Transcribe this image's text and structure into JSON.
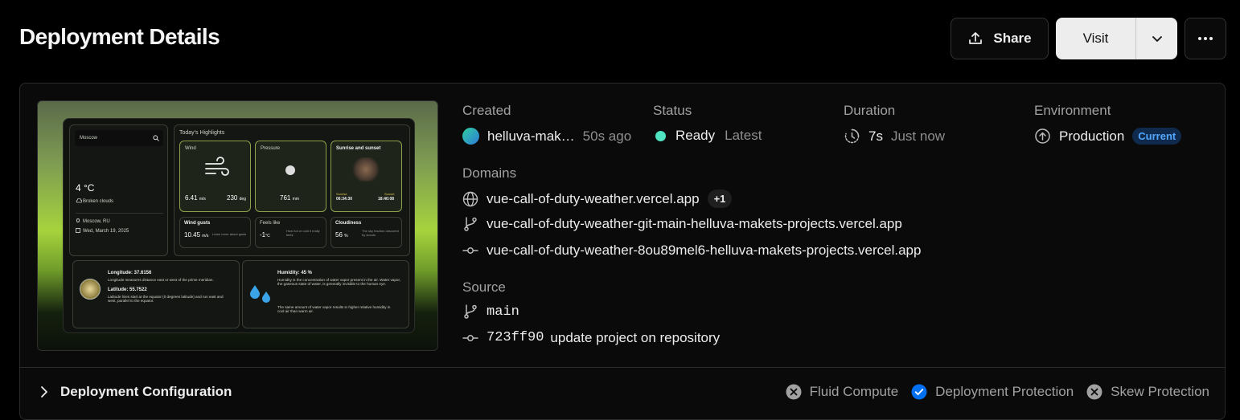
{
  "header": {
    "title": "Deployment Details",
    "share_label": "Share",
    "visit_label": "Visit"
  },
  "details": {
    "created": {
      "label": "Created",
      "user": "helluva-mak…",
      "time": "50s ago"
    },
    "status": {
      "label": "Status",
      "value": "Ready",
      "tag": "Latest",
      "color": "#50e3c2"
    },
    "duration": {
      "label": "Duration",
      "value": "7s",
      "when": "Just now"
    },
    "environment": {
      "label": "Environment",
      "value": "Production",
      "badge": "Current"
    }
  },
  "domains": {
    "label": "Domains",
    "primary": "vue-call-of-duty-weather.vercel.app",
    "extra_count": "+1",
    "branch": "vue-call-of-duty-weather-git-main-helluva-makets-projects.vercel.app",
    "commit": "vue-call-of-duty-weather-8ou89mel6-helluva-makets-projects.vercel.app"
  },
  "source": {
    "label": "Source",
    "branch": "main",
    "commit_hash": "723ff90",
    "commit_message": "update project on repository"
  },
  "footer": {
    "config_label": "Deployment Configuration",
    "flags": [
      {
        "label": "Fluid Compute",
        "state": "off"
      },
      {
        "label": "Deployment Protection",
        "state": "on"
      },
      {
        "label": "Skew Protection",
        "state": "off"
      }
    ]
  },
  "preview": {
    "city": "Moscow",
    "temp": "4 °C",
    "condition": "Broken clouds",
    "location": "Moscow, RU",
    "date": "Wed, March 19, 2025",
    "highlights_title": "Today's Highlights",
    "wind_label": "Wind",
    "wind_speed": "6.41",
    "wind_speed_unit": "m/s",
    "wind_deg": "230",
    "wind_deg_unit": "deg",
    "pressure_label": "Pressure",
    "pressure_value": "761",
    "pressure_unit": "mm",
    "sun_label": "Sunrise and sunset",
    "sunrise_label": "Sunrise",
    "sunrise": "06:34:30",
    "sunset_label": "Sunset",
    "sunset": "18:40:08",
    "gusts_label": "Wind gusts",
    "gusts_value": "10.45",
    "gusts_unit": "m/s",
    "gusts_hint": "Learn more about gusts",
    "feels_label": "Feels like",
    "feels_value": "-1",
    "feels_unit": "°C",
    "feels_hint": "How hot or cold it really feels",
    "cloud_label": "Cloudiness",
    "cloud_value": "56",
    "cloud_unit": "%",
    "cloud_hint": "The sky fraction obscured by clouds",
    "longitude": "Longitude: 37.6156",
    "longitude_desc": "Longitude measures distance east or west of the prime meridian.",
    "latitude": "Latitude: 55.7522",
    "latitude_desc": "Latitude lines start at the equator (0 degrees latitude) and run east and west, parallel to the equator.",
    "humidity": "Humidity: 45 %",
    "humidity_desc1": "Humidity is the concentration of water vapor present in the air. Water vapor, the gaseous state of water, is generally invisible to the human eye.",
    "humidity_desc2": "The same amount of water vapor results in higher relative humidity in cool air than warm air."
  }
}
